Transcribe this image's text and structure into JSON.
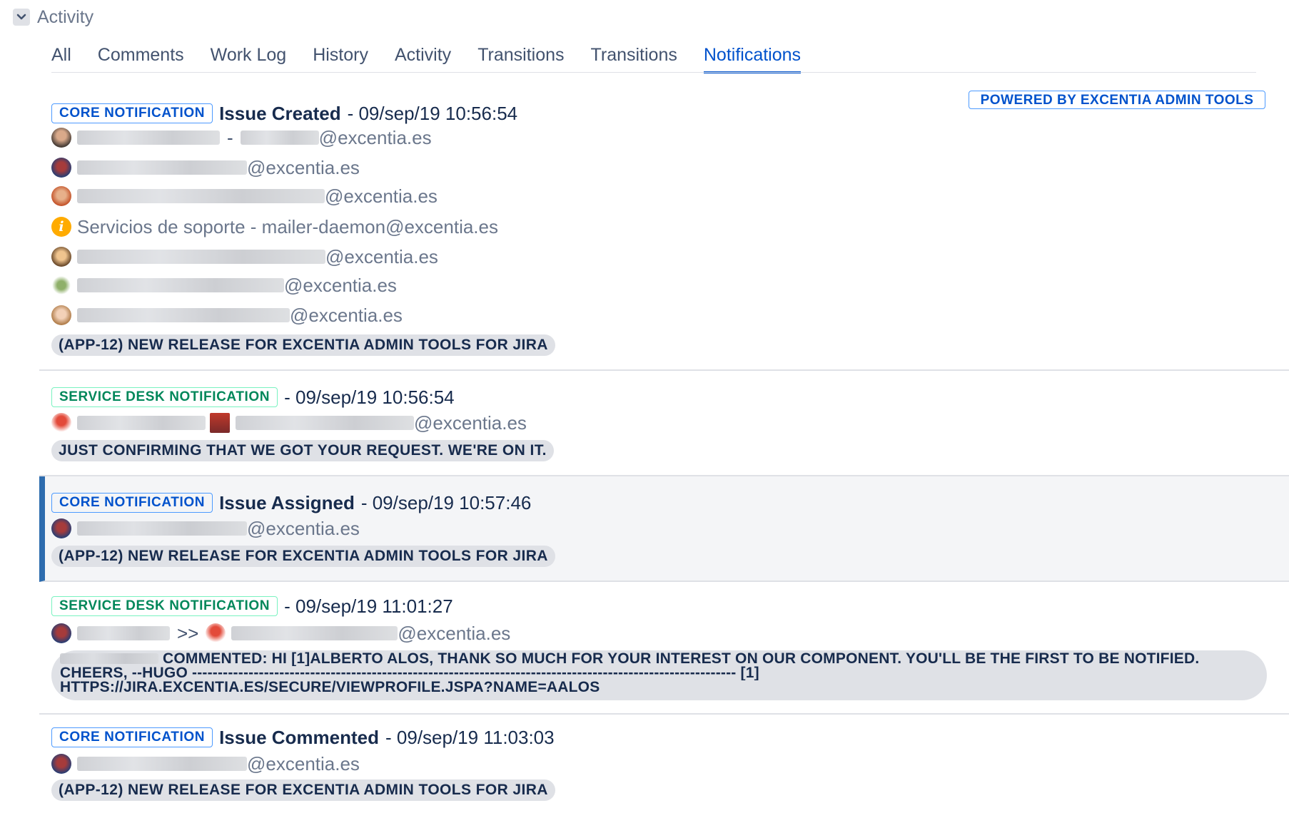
{
  "section": {
    "title": "Activity"
  },
  "tabs": [
    {
      "label": "All"
    },
    {
      "label": "Comments"
    },
    {
      "label": "Work Log"
    },
    {
      "label": "History"
    },
    {
      "label": "Activity"
    },
    {
      "label": "Transitions"
    },
    {
      "label": "Transitions"
    },
    {
      "label": "Notifications",
      "active": true
    }
  ],
  "powered_by": "POWERED BY EXCENTIA ADMIN TOOLS",
  "colors": {
    "accent": "#0052cc",
    "core_lozenge": "#0052cc",
    "sd_lozenge": "#00875a",
    "highlight_bar": "#2d6cae"
  },
  "entries": [
    {
      "type": "CORE NOTIFICATION",
      "event": "Issue Created",
      "timestamp": "- 09/sep/19 10:56:54",
      "recipients": [
        {
          "text": "@excentia.es"
        },
        {
          "text": "@excentia.es"
        },
        {
          "text": "@excentia.es"
        },
        {
          "text": "Servicios de soporte - mailer-daemon@excentia.es"
        },
        {
          "text": "@excentia.es"
        },
        {
          "text": "@excentia.es"
        },
        {
          "text": "@excentia.es"
        }
      ],
      "subject": "(APP-12) NEW RELEASE FOR EXCENTIA ADMIN TOOLS FOR JIRA"
    },
    {
      "type": "SERVICE DESK NOTIFICATION",
      "timestamp": "- 09/sep/19 10:56:54",
      "recipient": "@excentia.es",
      "subject": "JUST CONFIRMING THAT WE GOT YOUR REQUEST. WE'RE ON IT."
    },
    {
      "type": "CORE NOTIFICATION",
      "event": "Issue Assigned",
      "timestamp": "- 09/sep/19 10:57:46",
      "recipient": "@excentia.es",
      "subject": "(APP-12) NEW RELEASE FOR EXCENTIA ADMIN TOOLS FOR JIRA"
    },
    {
      "type": "SERVICE DESK NOTIFICATION",
      "timestamp": "- 09/sep/19 11:01:27",
      "separator": ">>",
      "recipient": "@excentia.es",
      "subject_lines": [
        "COMMENTED: HI [1]ALBERTO ALÓS, THANK SO MUCH FOR YOUR INTEREST ON OUR COMPONENT. YOU'LL BE THE FIRST TO BE NOTIFIED.",
        "CHEERS, --HUGO ---------------------------------------------------------------------------------------------------------- [1]",
        "HTTPS://JIRA.EXCENTIA.ES/SECURE/VIEWPROFILE.JSPA?NAME=AALOS"
      ]
    },
    {
      "type": "CORE NOTIFICATION",
      "event": "Issue Commented",
      "timestamp": "- 09/sep/19 11:03:03",
      "recipient": "@excentia.es",
      "subject": "(APP-12) NEW RELEASE FOR EXCENTIA ADMIN TOOLS FOR JIRA"
    }
  ]
}
